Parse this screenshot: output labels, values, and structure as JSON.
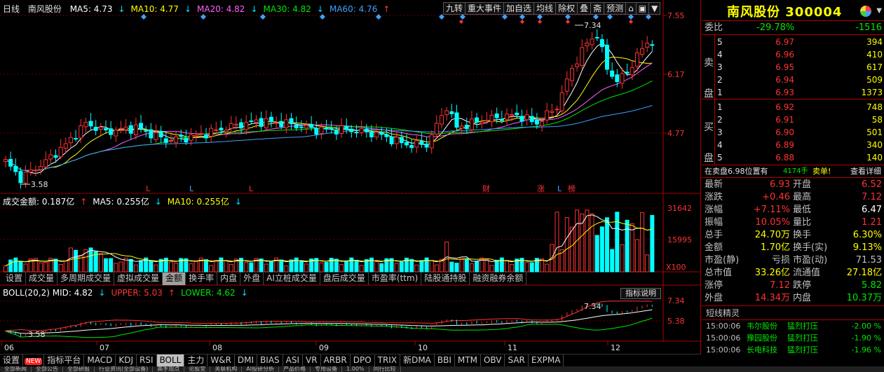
{
  "kline": {
    "period_label": "日线",
    "stock_name": "南风股份",
    "ma_legend": [
      {
        "label": "MA5: 4.73",
        "arrow": "↓",
        "color": "#ffffff",
        "arrow_color": "#00e0ff"
      },
      {
        "label": "MA10: 4.77",
        "arrow": "↓",
        "color": "#ffff00",
        "arrow_color": "#00e0ff"
      },
      {
        "label": "MA20: 4.82",
        "arrow": "↓",
        "color": "#ff60ff",
        "arrow_color": "#00e0ff"
      },
      {
        "label": "MA30: 4.82",
        "arrow": "↓",
        "color": "#00e600",
        "arrow_color": "#00e0ff"
      },
      {
        "label": "MA60: 4.76",
        "arrow": "↑",
        "color": "#40a0ff",
        "arrow_color": "#ff3232"
      }
    ],
    "price_axis": [
      "7.55",
      "6.17",
      "4.77"
    ],
    "high_marker": "7.34",
    "low_marker": "3.58",
    "event_marks": [
      {
        "text": "L",
        "color": "#ff3232"
      },
      {
        "text": "L",
        "color": "#40a0ff"
      },
      {
        "text": "L",
        "color": "#ff3232"
      },
      {
        "text": "财",
        "color": "#ff3232"
      },
      {
        "text": "涨",
        "color": "#ff3232"
      },
      {
        "text": "L",
        "color": "#40a0ff"
      },
      {
        "text": "榜",
        "color": "#ff3232"
      }
    ]
  },
  "toolbar": {
    "items": [
      "九转",
      "重大事件",
      "加自选",
      "均线",
      "除权",
      "叠",
      "斋",
      "预测",
      "⌂",
      "▣",
      "▼"
    ]
  },
  "volume": {
    "legend": [
      {
        "label": "成交金额: 0.187亿",
        "arrow": "↑",
        "color": "#ffffff",
        "arrow_color": "#ff3232"
      },
      {
        "label": "MA5: 0.255亿",
        "arrow": "↓",
        "color": "#ffffff",
        "arrow_color": "#00e0ff"
      },
      {
        "label": "MA10: 0.255亿",
        "arrow": "↓",
        "color": "#ffff00",
        "arrow_color": "#00e0ff"
      }
    ],
    "axis": [
      "31642",
      "15995",
      "X100"
    ]
  },
  "indicator_tabs": [
    "设置",
    "成交量",
    "多周期成交量",
    "虚拟成交量",
    "金额",
    "换手率",
    "内盘",
    "外盘",
    "AI立桩成交量",
    "盘后成交量",
    "市盈率(ttm)",
    "陆股通持股",
    "融资融券余额"
  ],
  "indicator_tab_active": 4,
  "boll": {
    "legend": [
      {
        "label": "BOLL(20,2) MID: 4.82",
        "arrow": "↓",
        "color": "#ffffff",
        "arrow_color": "#00e0ff"
      },
      {
        "label": "UPPER: 5.03",
        "arrow": "↑",
        "color": "#ff3232",
        "arrow_color": "#ff3232"
      },
      {
        "label": "LOWER: 4.62",
        "arrow": "↓",
        "color": "#00e600",
        "arrow_color": "#00e0ff"
      }
    ],
    "axis": [
      "7.34",
      "5.38"
    ],
    "high_marker": "7.34",
    "low_marker": "3.58",
    "button_label": "指标说明"
  },
  "months": [
    "06",
    "07",
    "08",
    "09",
    "10",
    "11",
    "12"
  ],
  "bottom_tabs": {
    "items": [
      "设置",
      "NEW",
      "指标平台",
      "MACD",
      "KDJ",
      "RSI",
      "BOLL",
      "主力",
      "W&R",
      "DMI",
      "BIAS",
      "ASI",
      "VR",
      "ARBR",
      "DPO",
      "TRIX",
      "新DMA",
      "BBI",
      "MTM",
      "OBV",
      "SAR",
      "EXPMA"
    ],
    "active": "BOLL"
  },
  "status_bar": [
    "全部新闻",
    "全部公告",
    "全部研报",
    "行业资讯(全部设备)",
    "高手观点",
    "论股堂",
    "关联机构",
    "AI投研分析",
    "产品价格",
    "专用设备",
    "1.00%",
    "同行比较"
  ],
  "panel": {
    "title": "南风股份 300004",
    "webi": {
      "label": "委比",
      "ratio": "-29.78%",
      "diff": "-1516"
    },
    "sell_label": [
      "卖",
      "盘"
    ],
    "buy_label": [
      "买",
      "盘"
    ],
    "asks": [
      {
        "level": "5",
        "price": "6.97",
        "vol": "394"
      },
      {
        "level": "4",
        "price": "6.96",
        "vol": "410"
      },
      {
        "level": "3",
        "price": "6.95",
        "vol": "617"
      },
      {
        "level": "2",
        "price": "6.94",
        "vol": "509"
      },
      {
        "level": "1",
        "price": "6.93",
        "vol": "1373"
      }
    ],
    "bids": [
      {
        "level": "1",
        "price": "6.92",
        "vol": "748"
      },
      {
        "level": "2",
        "price": "6.91",
        "vol": "58"
      },
      {
        "level": "3",
        "price": "6.90",
        "vol": "501"
      },
      {
        "level": "4",
        "price": "6.89",
        "vol": "340"
      },
      {
        "level": "5",
        "price": "6.88",
        "vol": "140"
      }
    ],
    "notice": {
      "text": "在卖盘6.98位置有",
      "volume": "4174手",
      "action": "卖单!",
      "link": "查看详细"
    },
    "quotes": [
      {
        "l1": "最新",
        "v1": "6.93",
        "c1": "#ff3232",
        "l2": "开盘",
        "v2": "6.52",
        "c2": "#ff3232"
      },
      {
        "l1": "涨跌",
        "v1": "+0.46",
        "c1": "#ff3232",
        "l2": "最高",
        "v2": "7.12",
        "c2": "#ff3232"
      },
      {
        "l1": "涨幅",
        "v1": "+7.11%",
        "c1": "#ff3232",
        "l2": "最低",
        "v2": "6.47",
        "c2": "#ffffff"
      },
      {
        "l1": "振幅",
        "v1": "10.05%",
        "c1": "#ff3232",
        "l2": "量比",
        "v2": "1.21",
        "c2": "#ff3232"
      },
      {
        "l1": "总手",
        "v1": "24.70万",
        "c1": "#ffff00",
        "l2": "换手",
        "v2": "6.30%",
        "c2": "#ffff00"
      },
      {
        "l1": "金额",
        "v1": "1.70亿",
        "c1": "#ffff00",
        "l2": "换手(实)",
        "v2": "9.13%",
        "c2": "#ffff00"
      },
      {
        "l1": "市盈(静)",
        "v1": "亏损",
        "c1": "#c0c0c0",
        "l2": "市盈(动)",
        "v2": "71.53",
        "c2": "#c0c0c0"
      },
      {
        "l1": "总市值",
        "v1": "33.26亿",
        "c1": "#ffff00",
        "l2": "流通值",
        "v2": "27.18亿",
        "c2": "#ffff00"
      },
      {
        "l1": "涨停",
        "v1": "7.12",
        "c1": "#ff3232",
        "l2": "跌停",
        "v2": "5.82",
        "c2": "#00e600"
      },
      {
        "l1": "外盘",
        "v1": "14.34万",
        "c1": "#ff3232",
        "l2": "内盘",
        "v2": "10.37万",
        "c2": "#00e600"
      }
    ],
    "brief_title": "短线精灵",
    "brief": [
      {
        "time": "15:00:06",
        "stock": "韦尔股份",
        "event": "猛烈打压",
        "pct": "-2.00 %"
      },
      {
        "time": "15:00:06",
        "stock": "豫园股份",
        "event": "猛烈打压",
        "pct": "-1.90 %"
      },
      {
        "time": "15:00:06",
        "stock": "长电科技",
        "event": "猛烈打压",
        "pct": "-1.96 %"
      }
    ]
  }
}
